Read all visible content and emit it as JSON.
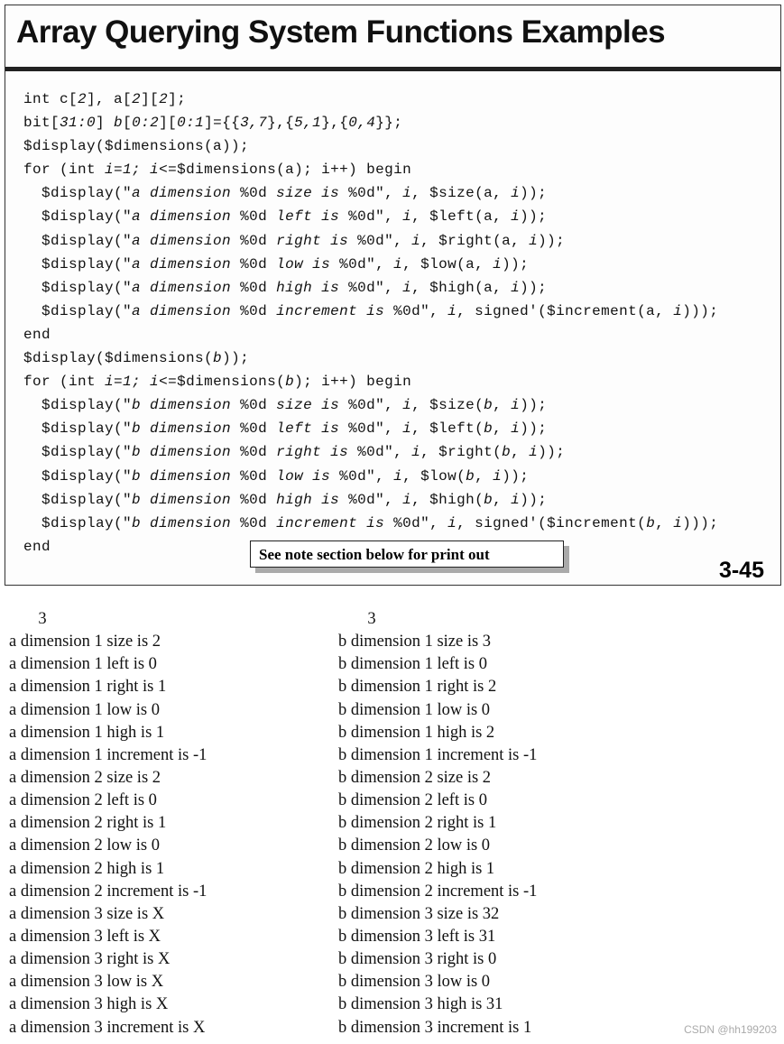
{
  "title": "Array Querying System Functions Examples",
  "code": [
    [
      [
        "int c[",
        0
      ],
      [
        "2",
        1
      ],
      [
        "], a[",
        0
      ],
      [
        "2",
        1
      ],
      [
        "][",
        0
      ],
      [
        "2",
        1
      ],
      [
        "];",
        0
      ]
    ],
    [
      [
        "bit[",
        0
      ],
      [
        "31:0",
        1
      ],
      [
        "] ",
        0
      ],
      [
        "b",
        1
      ],
      [
        "[",
        0
      ],
      [
        "0:2",
        1
      ],
      [
        "][",
        0
      ],
      [
        "0:1",
        1
      ],
      [
        "]={{",
        0
      ],
      [
        "3,7",
        1
      ],
      [
        "},{",
        0
      ],
      [
        "5,1",
        1
      ],
      [
        "},{",
        0
      ],
      [
        "0,4",
        1
      ],
      [
        "}};",
        0
      ]
    ],
    [
      [
        "$display($dimensions(a));",
        0
      ]
    ],
    [
      [
        "for (int ",
        0
      ],
      [
        "i=1;",
        1
      ],
      [
        " ",
        0
      ],
      [
        "i",
        1
      ],
      [
        "<=$dimensions(a); i++) begin",
        0
      ]
    ],
    [
      [
        "  $display(\"",
        0
      ],
      [
        "a dimension",
        1
      ],
      [
        " %0d ",
        0
      ],
      [
        "size is",
        1
      ],
      [
        " %0d\", ",
        0
      ],
      [
        "i",
        1
      ],
      [
        ", $size(a, ",
        0
      ],
      [
        "i",
        1
      ],
      [
        "));",
        0
      ]
    ],
    [
      [
        "  $display(\"",
        0
      ],
      [
        "a dimension",
        1
      ],
      [
        " %0d ",
        0
      ],
      [
        "left is",
        1
      ],
      [
        " %0d\", ",
        0
      ],
      [
        "i",
        1
      ],
      [
        ", $left(a, ",
        0
      ],
      [
        "i",
        1
      ],
      [
        "));",
        0
      ]
    ],
    [
      [
        "  $display(\"",
        0
      ],
      [
        "a dimension",
        1
      ],
      [
        " %0d ",
        0
      ],
      [
        "right is",
        1
      ],
      [
        " %0d\", ",
        0
      ],
      [
        "i",
        1
      ],
      [
        ", $right(a, ",
        0
      ],
      [
        "i",
        1
      ],
      [
        "));",
        0
      ]
    ],
    [
      [
        "  $display(\"",
        0
      ],
      [
        "a dimension",
        1
      ],
      [
        " %0d ",
        0
      ],
      [
        "low is",
        1
      ],
      [
        " %0d\", ",
        0
      ],
      [
        "i",
        1
      ],
      [
        ", $low(a, ",
        0
      ],
      [
        "i",
        1
      ],
      [
        "));",
        0
      ]
    ],
    [
      [
        "  $display(\"",
        0
      ],
      [
        "a dimension",
        1
      ],
      [
        " %0d ",
        0
      ],
      [
        "high is",
        1
      ],
      [
        " %0d\", ",
        0
      ],
      [
        "i",
        1
      ],
      [
        ", $high(a, ",
        0
      ],
      [
        "i",
        1
      ],
      [
        "));",
        0
      ]
    ],
    [
      [
        "  $display(\"",
        0
      ],
      [
        "a dimension",
        1
      ],
      [
        " %0d ",
        0
      ],
      [
        "increment is",
        1
      ],
      [
        " %0d\", ",
        0
      ],
      [
        "i",
        1
      ],
      [
        ", signed'($increment(a, ",
        0
      ],
      [
        "i",
        1
      ],
      [
        ")));",
        0
      ]
    ],
    [
      [
        "end",
        0
      ]
    ],
    [
      [
        "$display($dimensions(",
        0
      ],
      [
        "b",
        1
      ],
      [
        "));",
        0
      ]
    ],
    [
      [
        "for (int ",
        0
      ],
      [
        "i=1;",
        1
      ],
      [
        " ",
        0
      ],
      [
        "i",
        1
      ],
      [
        "<=$dimensions(",
        0
      ],
      [
        "b",
        1
      ],
      [
        "); i++) begin",
        0
      ]
    ],
    [
      [
        "  $display(\"",
        0
      ],
      [
        "b dimension",
        1
      ],
      [
        " %0d ",
        0
      ],
      [
        "size is",
        1
      ],
      [
        " %0d\", ",
        0
      ],
      [
        "i",
        1
      ],
      [
        ", $size(",
        0
      ],
      [
        "b",
        1
      ],
      [
        ", ",
        0
      ],
      [
        "i",
        1
      ],
      [
        "));",
        0
      ]
    ],
    [
      [
        "  $display(\"",
        0
      ],
      [
        "b dimension",
        1
      ],
      [
        " %0d ",
        0
      ],
      [
        "left is",
        1
      ],
      [
        " %0d\", ",
        0
      ],
      [
        "i",
        1
      ],
      [
        ", $left(",
        0
      ],
      [
        "b",
        1
      ],
      [
        ", ",
        0
      ],
      [
        "i",
        1
      ],
      [
        "));",
        0
      ]
    ],
    [
      [
        "  $display(\"",
        0
      ],
      [
        "b dimension",
        1
      ],
      [
        " %0d ",
        0
      ],
      [
        "right is",
        1
      ],
      [
        " %0d\", ",
        0
      ],
      [
        "i",
        1
      ],
      [
        ", $right(",
        0
      ],
      [
        "b",
        1
      ],
      [
        ", ",
        0
      ],
      [
        "i",
        1
      ],
      [
        "));",
        0
      ]
    ],
    [
      [
        "  $display(\"",
        0
      ],
      [
        "b dimension",
        1
      ],
      [
        " %0d ",
        0
      ],
      [
        "low is",
        1
      ],
      [
        " %0d\", ",
        0
      ],
      [
        "i",
        1
      ],
      [
        ", $low(",
        0
      ],
      [
        "b",
        1
      ],
      [
        ", ",
        0
      ],
      [
        "i",
        1
      ],
      [
        "));",
        0
      ]
    ],
    [
      [
        "  $display(\"",
        0
      ],
      [
        "b dimension",
        1
      ],
      [
        " %0d ",
        0
      ],
      [
        "high is",
        1
      ],
      [
        " %0d\", ",
        0
      ],
      [
        "i",
        1
      ],
      [
        ", $high(",
        0
      ],
      [
        "b",
        1
      ],
      [
        ", ",
        0
      ],
      [
        "i",
        1
      ],
      [
        "));",
        0
      ]
    ],
    [
      [
        "  $display(\"",
        0
      ],
      [
        "b dimension",
        1
      ],
      [
        " %0d ",
        0
      ],
      [
        "increment is",
        1
      ],
      [
        " %0d\", ",
        0
      ],
      [
        "i",
        1
      ],
      [
        ", signed'($increment(",
        0
      ],
      [
        "b",
        1
      ],
      [
        ", ",
        0
      ],
      [
        "i",
        1
      ],
      [
        ")));",
        0
      ]
    ],
    [
      [
        "end",
        0
      ]
    ]
  ],
  "note": "See note section below for print out",
  "page_number": "3-45",
  "output_a": [
    "       3",
    "a dimension 1 size is 2",
    "a dimension 1 left is 0",
    "a dimension 1 right is 1",
    "a dimension 1 low is 0",
    "a dimension 1 high is 1",
    "a dimension 1 increment is -1",
    "a dimension 2 size is 2",
    "a dimension 2 left is 0",
    "a dimension 2 right is 1",
    "a dimension 2 low is 0",
    "a dimension 2 high is 1",
    "a dimension 2 increment is -1",
    "a dimension 3 size is X",
    "a dimension 3 left is X",
    "a dimension 3 right is X",
    "a dimension 3 low is X",
    "a dimension 3 high is X",
    "a dimension 3 increment is X"
  ],
  "output_b": [
    "       3",
    "b dimension 1 size is 3",
    "b dimension 1 left is 0",
    "b dimension 1 right is 2",
    "b dimension 1 low is 0",
    "b dimension 1 high is 2",
    "b dimension 1 increment is -1",
    "b dimension 2 size is 2",
    "b dimension 2 left is 0",
    "b dimension 2 right is 1",
    "b dimension 2 low is 0",
    "b dimension 2 high is 1",
    "b dimension 2 increment is -1",
    "b dimension 3 size is 32",
    "b dimension 3 left is 31",
    "b dimension 3 right is 0",
    "b dimension 3 low is 0",
    "b dimension 3 high is 31",
    "b dimension 3 increment is 1"
  ],
  "watermark": "CSDN @hh199203"
}
